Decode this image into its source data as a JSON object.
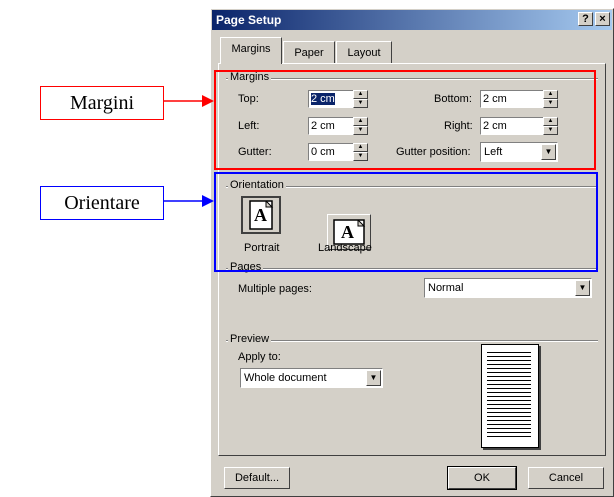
{
  "window": {
    "title": "Page Setup",
    "help_glyph": "?",
    "close_glyph": "×"
  },
  "tabs": [
    {
      "label": "Margins"
    },
    {
      "label": "Paper"
    },
    {
      "label": "Layout"
    }
  ],
  "margins": {
    "group_label": "Margins",
    "top": {
      "label": "Top:",
      "value": "2 cm"
    },
    "bottom": {
      "label": "Bottom:",
      "value": "2 cm"
    },
    "left": {
      "label": "Left:",
      "value": "2 cm"
    },
    "right": {
      "label": "Right:",
      "value": "2 cm"
    },
    "gutter": {
      "label": "Gutter:",
      "value": "0 cm"
    },
    "gutter_position": {
      "label": "Gutter position:",
      "value": "Left"
    }
  },
  "orientation": {
    "group_label": "Orientation",
    "portrait": "Portrait",
    "landscape": "Landscape",
    "icon_letter": "A"
  },
  "pages": {
    "group_label": "Pages",
    "multiple_label": "Multiple pages:",
    "multiple_value": "Normal"
  },
  "preview": {
    "group_label": "Preview",
    "apply_label": "Apply to:",
    "apply_value": "Whole document"
  },
  "buttons": {
    "default": "Default...",
    "ok": "OK",
    "cancel": "Cancel"
  },
  "annotations": {
    "margins": "Margini",
    "orientation": "Orientare"
  },
  "colors": {
    "annotation_red": "#ff0000",
    "annotation_blue": "#0000ff",
    "title_dark": "#0a246a",
    "dialog_face": "#d4d0c8"
  }
}
